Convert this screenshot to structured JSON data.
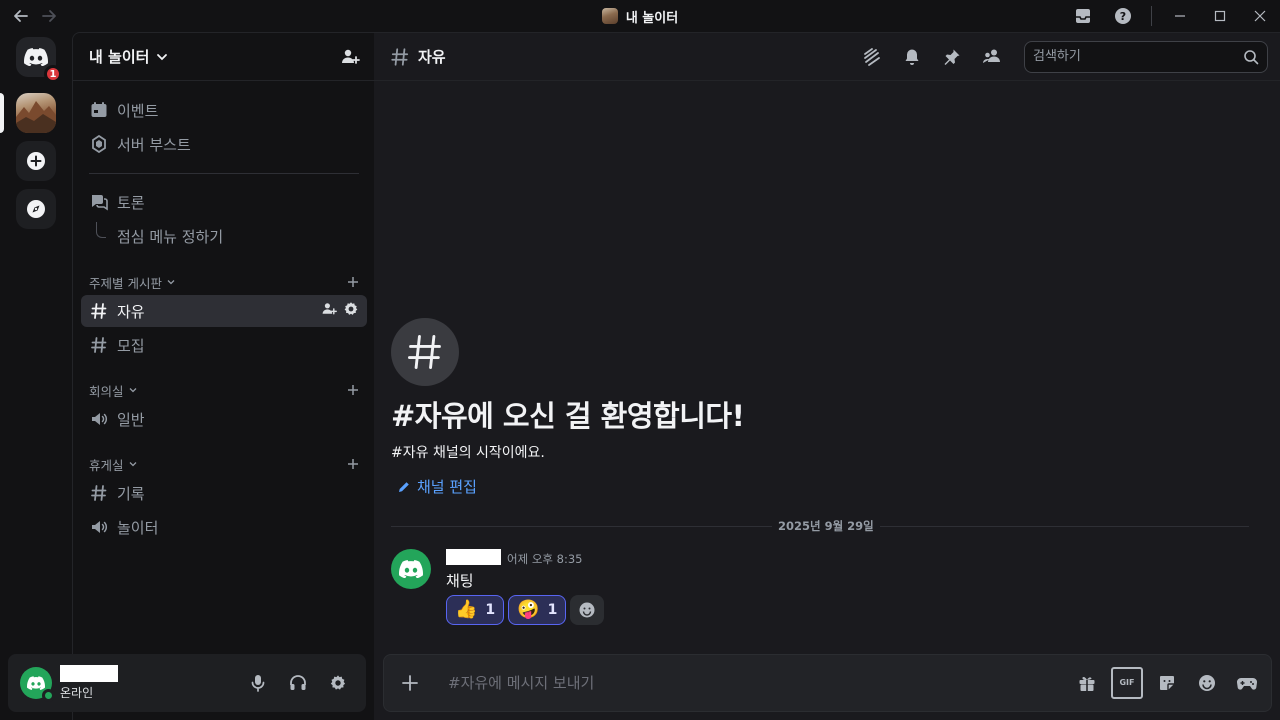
{
  "window": {
    "title": "내 놀이터"
  },
  "server": {
    "name": "내 놀이터",
    "home_badge": "1"
  },
  "sidebar": {
    "top_items": [
      {
        "label": "이벤트"
      },
      {
        "label": "서버 부스트"
      }
    ],
    "forum": {
      "label": "토론"
    },
    "thread": {
      "label": "점심 메뉴 정하기"
    },
    "categories": [
      {
        "name": "주제별 게시판",
        "channels": [
          "자유",
          "모집"
        ]
      },
      {
        "name": "회의실",
        "channels": [
          "일반"
        ]
      },
      {
        "name": "휴게실",
        "channels": [
          "기록",
          "놀이터"
        ]
      }
    ]
  },
  "user": {
    "status": "온라인"
  },
  "channel": {
    "name": "자유",
    "search_placeholder": "검색하기"
  },
  "welcome": {
    "title": "#자유에 오신 걸 환영합니다!",
    "subtitle": "#자유 채널의 시작이에요.",
    "edit_label": "채널 편집"
  },
  "messages": {
    "date_divider": "2025년 9월 29일",
    "items": [
      {
        "time": "어제 오후 8:35",
        "text": "채팅",
        "reactions": [
          {
            "emoji": "👍",
            "count": "1"
          },
          {
            "emoji": "🤪",
            "count": "1"
          }
        ]
      }
    ]
  },
  "composer": {
    "placeholder": "#자유에 메시지 보내기"
  },
  "colors": {
    "accent": "#5865f2",
    "online": "#23a55a",
    "link": "#5aa1ff",
    "badge": "#da373c"
  }
}
